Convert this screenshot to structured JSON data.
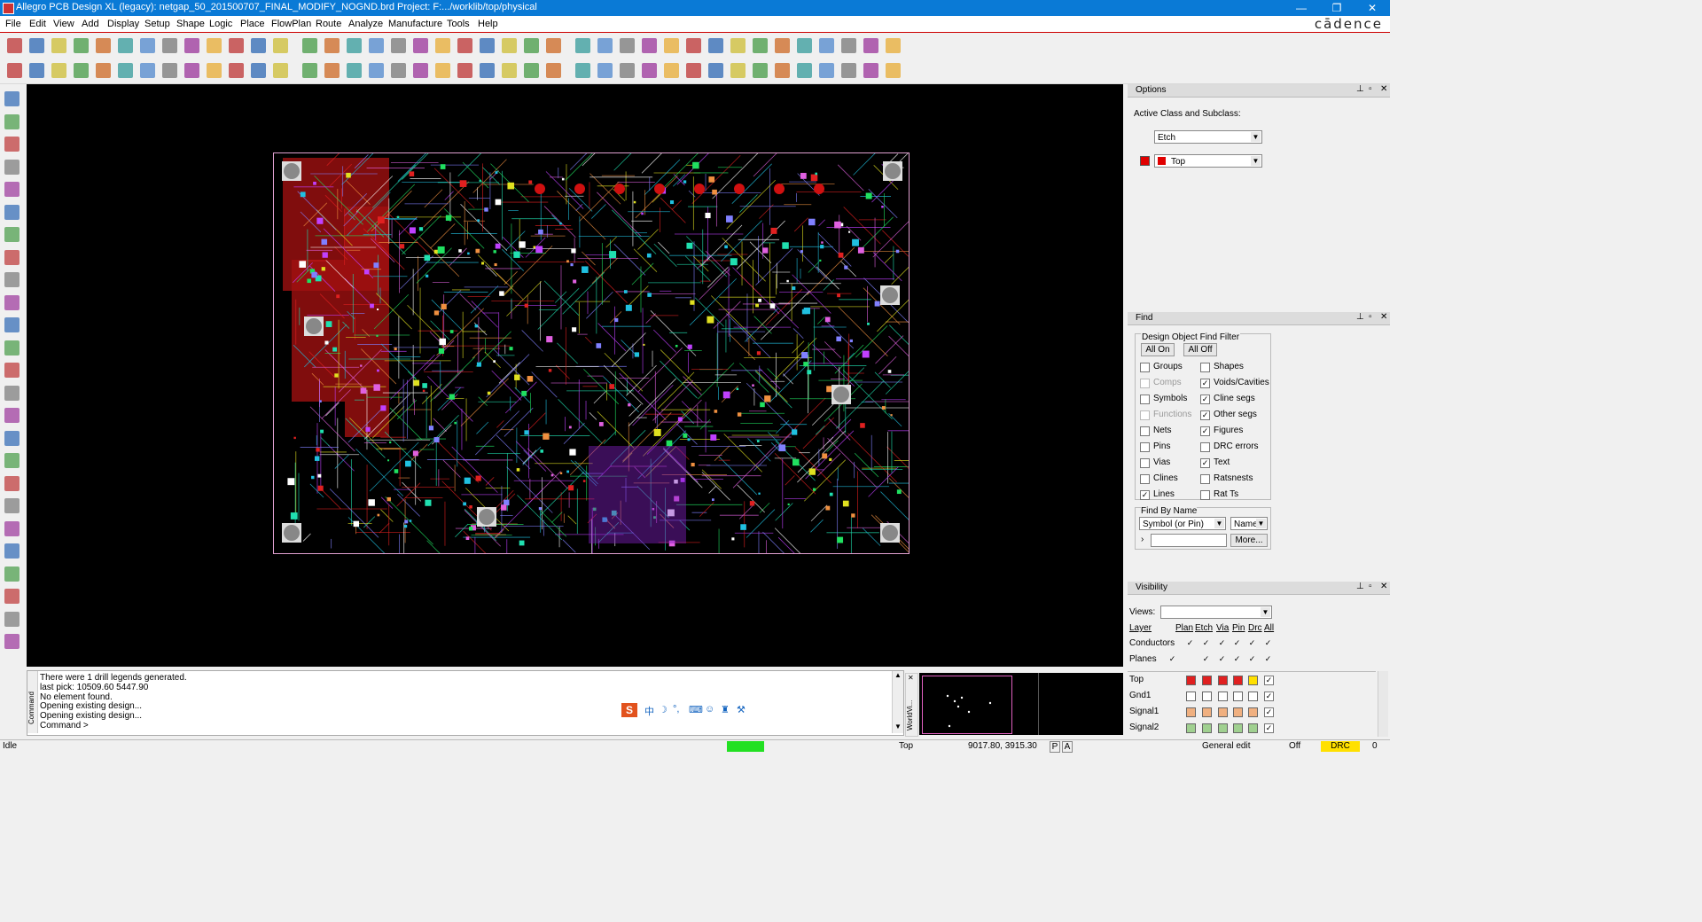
{
  "window": {
    "title": "Allegro PCB Design XL (legacy): netgap_50_201500707_FINAL_MODIFY_NOGND.brd  Project: F:.../worklib/top/physical",
    "brand": "cādence",
    "min_glyph": "—",
    "max_glyph": "❐",
    "close_glyph": "✕"
  },
  "menu": [
    "File",
    "Edit",
    "View",
    "Add",
    "Display",
    "Setup",
    "Shape",
    "Logic",
    "Place",
    "FlowPlan",
    "Route",
    "Analyze",
    "Manufacture",
    "Tools",
    "Help"
  ],
  "options": {
    "title": "Options",
    "active_label": "Active Class and Subclass:",
    "class_value": "Etch",
    "subclass_value": "Top",
    "subclass_color": "#e00000"
  },
  "find": {
    "title": "Find",
    "filter_title": "Design Object Find Filter",
    "all_on": "All On",
    "all_off": "All Off",
    "left_items": [
      {
        "label": "Groups",
        "checked": false,
        "enabled": true
      },
      {
        "label": "Comps",
        "checked": false,
        "enabled": false
      },
      {
        "label": "Symbols",
        "checked": false,
        "enabled": true
      },
      {
        "label": "Functions",
        "checked": false,
        "enabled": false
      },
      {
        "label": "Nets",
        "checked": false,
        "enabled": true
      },
      {
        "label": "Pins",
        "checked": false,
        "enabled": true
      },
      {
        "label": "Vias",
        "checked": false,
        "enabled": true
      },
      {
        "label": "Clines",
        "checked": false,
        "enabled": true
      },
      {
        "label": "Lines",
        "checked": true,
        "enabled": true
      }
    ],
    "right_items": [
      {
        "label": "Shapes",
        "checked": false,
        "enabled": true
      },
      {
        "label": "Voids/Cavities",
        "checked": true,
        "enabled": true
      },
      {
        "label": "Cline segs",
        "checked": true,
        "enabled": true
      },
      {
        "label": "Other segs",
        "checked": true,
        "enabled": true
      },
      {
        "label": "Figures",
        "checked": true,
        "enabled": true
      },
      {
        "label": "DRC errors",
        "checked": false,
        "enabled": true
      },
      {
        "label": "Text",
        "checked": true,
        "enabled": true
      },
      {
        "label": "Ratsnests",
        "checked": false,
        "enabled": true
      },
      {
        "label": "Rat Ts",
        "checked": false,
        "enabled": true
      }
    ],
    "by_name_title": "Find By Name",
    "by_name_type": "Symbol (or Pin)",
    "by_name_mode": "Name",
    "more_button": "More..."
  },
  "visibility": {
    "title": "Visibility",
    "views_label": "Views:",
    "columns": [
      "Layer",
      "Plan",
      "Etch",
      "Via",
      "Pin",
      "Drc",
      "All"
    ],
    "group_rows": [
      {
        "label": "Conductors",
        "checks": [
          true,
          true,
          true,
          true,
          true,
          true
        ]
      },
      {
        "label": "Planes",
        "checks": [
          true,
          true,
          true,
          true,
          true,
          true
        ]
      }
    ],
    "layers": [
      {
        "label": "Top",
        "color": "#e02020",
        "checks": [
          true,
          true,
          true,
          true,
          true,
          true
        ]
      },
      {
        "label": "Gnd1",
        "color": "#ffffff",
        "checks": [
          false,
          false,
          false,
          false,
          false,
          false
        ]
      },
      {
        "label": "Signal1",
        "color": "#f0b080",
        "checks": [
          false,
          false,
          false,
          false,
          false,
          false
        ]
      },
      {
        "label": "Signal2",
        "color": "#a0d090",
        "checks": [
          false,
          false,
          false,
          false,
          false,
          false
        ]
      }
    ]
  },
  "command": {
    "tab_label": "Command",
    "lines": [
      "There were 1 drill legends generated.",
      "last pick:  10509.60  5447.90",
      "No element found.",
      "Opening existing design...",
      "Opening existing design...",
      "Command >"
    ]
  },
  "ime": {
    "label": "中"
  },
  "worldview_label": "WorldVi...",
  "status": {
    "state": "Idle",
    "active_layer": "Top",
    "coords": "9017.80, 3915.30",
    "p_btn": "P",
    "a_btn": "A",
    "mode": "General edit",
    "off": "Off",
    "drc": "DRC",
    "count": "0"
  }
}
